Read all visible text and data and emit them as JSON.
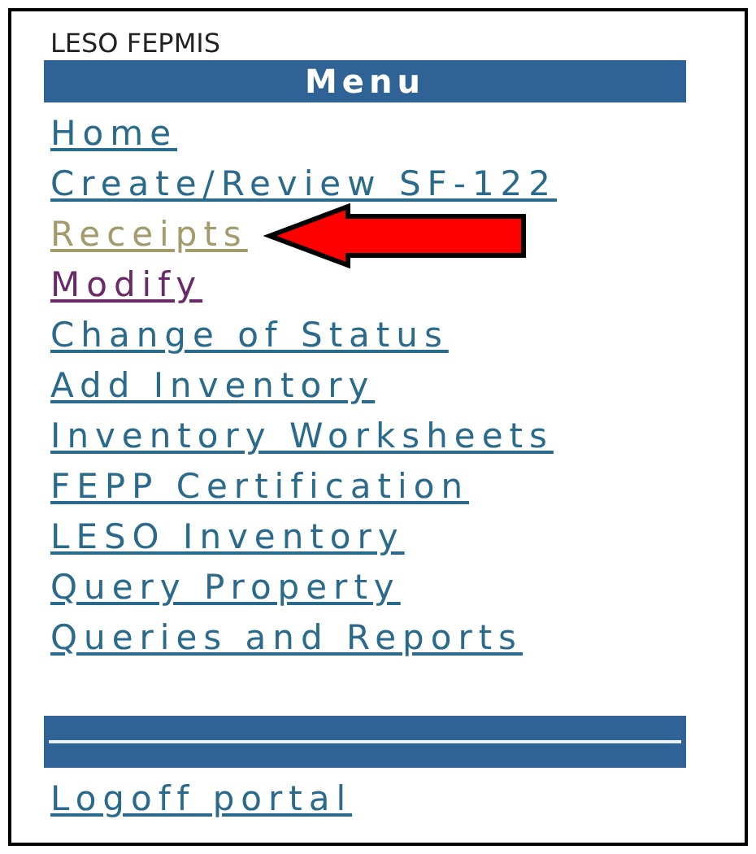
{
  "header": {
    "title": "LESO FEPMIS"
  },
  "menu": {
    "title": "Menu",
    "items": [
      {
        "label": "Home",
        "visited": false,
        "hovered": false,
        "pointed": false
      },
      {
        "label": "Create/Review SF-122",
        "visited": false,
        "hovered": false,
        "pointed": false
      },
      {
        "label": "Receipts",
        "visited": false,
        "hovered": true,
        "pointed": true
      },
      {
        "label": "Modify",
        "visited": true,
        "hovered": false,
        "pointed": false
      },
      {
        "label": "Change of Status",
        "visited": false,
        "hovered": false,
        "pointed": false
      },
      {
        "label": "Add Inventory",
        "visited": false,
        "hovered": false,
        "pointed": false
      },
      {
        "label": "Inventory Worksheets",
        "visited": false,
        "hovered": false,
        "pointed": false
      },
      {
        "label": "FEPP Certification",
        "visited": false,
        "hovered": false,
        "pointed": false
      },
      {
        "label": "LESO Inventory",
        "visited": false,
        "hovered": false,
        "pointed": false
      },
      {
        "label": "Query Property",
        "visited": false,
        "hovered": false,
        "pointed": false
      },
      {
        "label": "Queries and Reports",
        "visited": false,
        "hovered": false,
        "pointed": false
      }
    ]
  },
  "footer_links": [
    {
      "label": "Logoff portal",
      "visited": false,
      "hovered": false,
      "pointed": false
    }
  ]
}
